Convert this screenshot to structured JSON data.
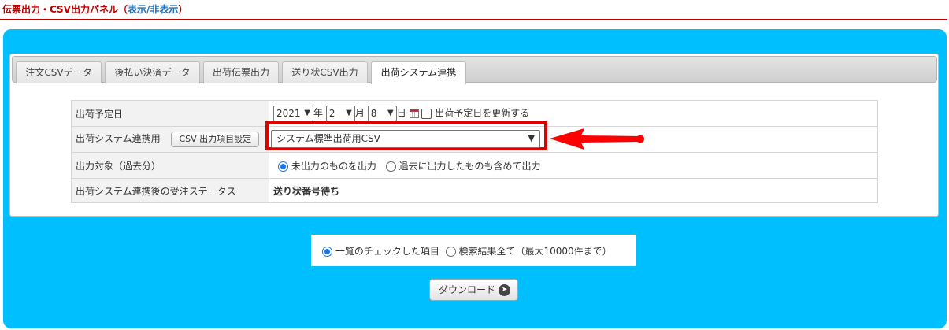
{
  "header": {
    "title": "伝票出力・CSV出力パネル",
    "toggle_open": "（",
    "toggle_link": "表示/非表示",
    "toggle_close": "）"
  },
  "tabs": [
    {
      "label": "注文CSVデータ",
      "active": false
    },
    {
      "label": "後払い決済データ",
      "active": false
    },
    {
      "label": "出荷伝票出力",
      "active": false
    },
    {
      "label": "送り状CSV出力",
      "active": false
    },
    {
      "label": "出荷システム連携",
      "active": true
    }
  ],
  "form": {
    "ship_date": {
      "label": "出荷予定日",
      "year": "2021",
      "year_unit": "年",
      "month": "2",
      "month_unit": "月",
      "day": "8",
      "day_unit": "日",
      "update_label": "出荷予定日を更新する"
    },
    "csv_system": {
      "label": "出荷システム連携用",
      "settings_button": "CSV 出力項目設定",
      "selected": "システム標準出荷用CSV"
    },
    "target": {
      "label": "出力対象（過去分）",
      "option1": "未出力のものを出力",
      "option2": "過去に出力したものも含めて出力",
      "selected": "option1"
    },
    "status_after": {
      "label": "出荷システム連携後の受注ステータス",
      "value": "送り状番号待ち"
    }
  },
  "scope": {
    "option1": "一覧のチェックした項目",
    "option2": "検索結果全て（最大10000件まで）",
    "selected": "option1"
  },
  "download": {
    "label": "ダウンロード"
  },
  "colors": {
    "panel": "#00bfff",
    "accent_red": "#e00000",
    "title_red": "#c00000",
    "link_blue": "#1a6fc0"
  },
  "icons": [
    "calendar-icon",
    "chevron-down-icon",
    "arrow-right-circle-icon",
    "red-arrow-left-icon"
  ]
}
